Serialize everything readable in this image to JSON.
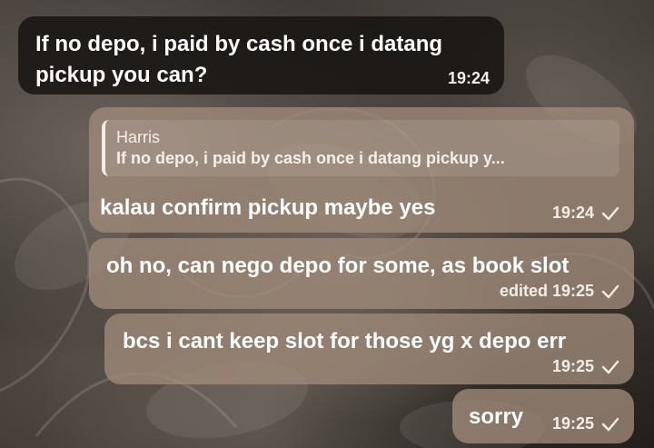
{
  "chat": {
    "messages": [
      {
        "id": "m1",
        "direction": "incoming",
        "lines": [
          "If no depo, i paid by cash once i datang",
          "pickup you can?"
        ],
        "time": "19:24"
      },
      {
        "id": "m2",
        "direction": "outgoing",
        "reply": {
          "author": "Harris",
          "text": "If no depo, i paid by cash once i datang pickup y..."
        },
        "text": "kalau confirm pickup maybe yes",
        "time": "19:24",
        "status_icon": "check-icon"
      },
      {
        "id": "m3",
        "direction": "outgoing",
        "text": "oh no, can nego depo for some, as book slot",
        "time": "edited 19:25",
        "status_icon": "check-icon"
      },
      {
        "id": "m4",
        "direction": "outgoing",
        "text": "bcs i cant keep slot for those yg x depo err",
        "time": "19:25",
        "status_icon": "check-icon"
      },
      {
        "id": "m5",
        "direction": "outgoing",
        "text": "sorry",
        "time": "19:25",
        "status_icon": "check-icon"
      }
    ]
  },
  "colors": {
    "incoming_bubble": "#161412",
    "outgoing_bubble": "#a08a7a",
    "text": "#ffffff"
  }
}
